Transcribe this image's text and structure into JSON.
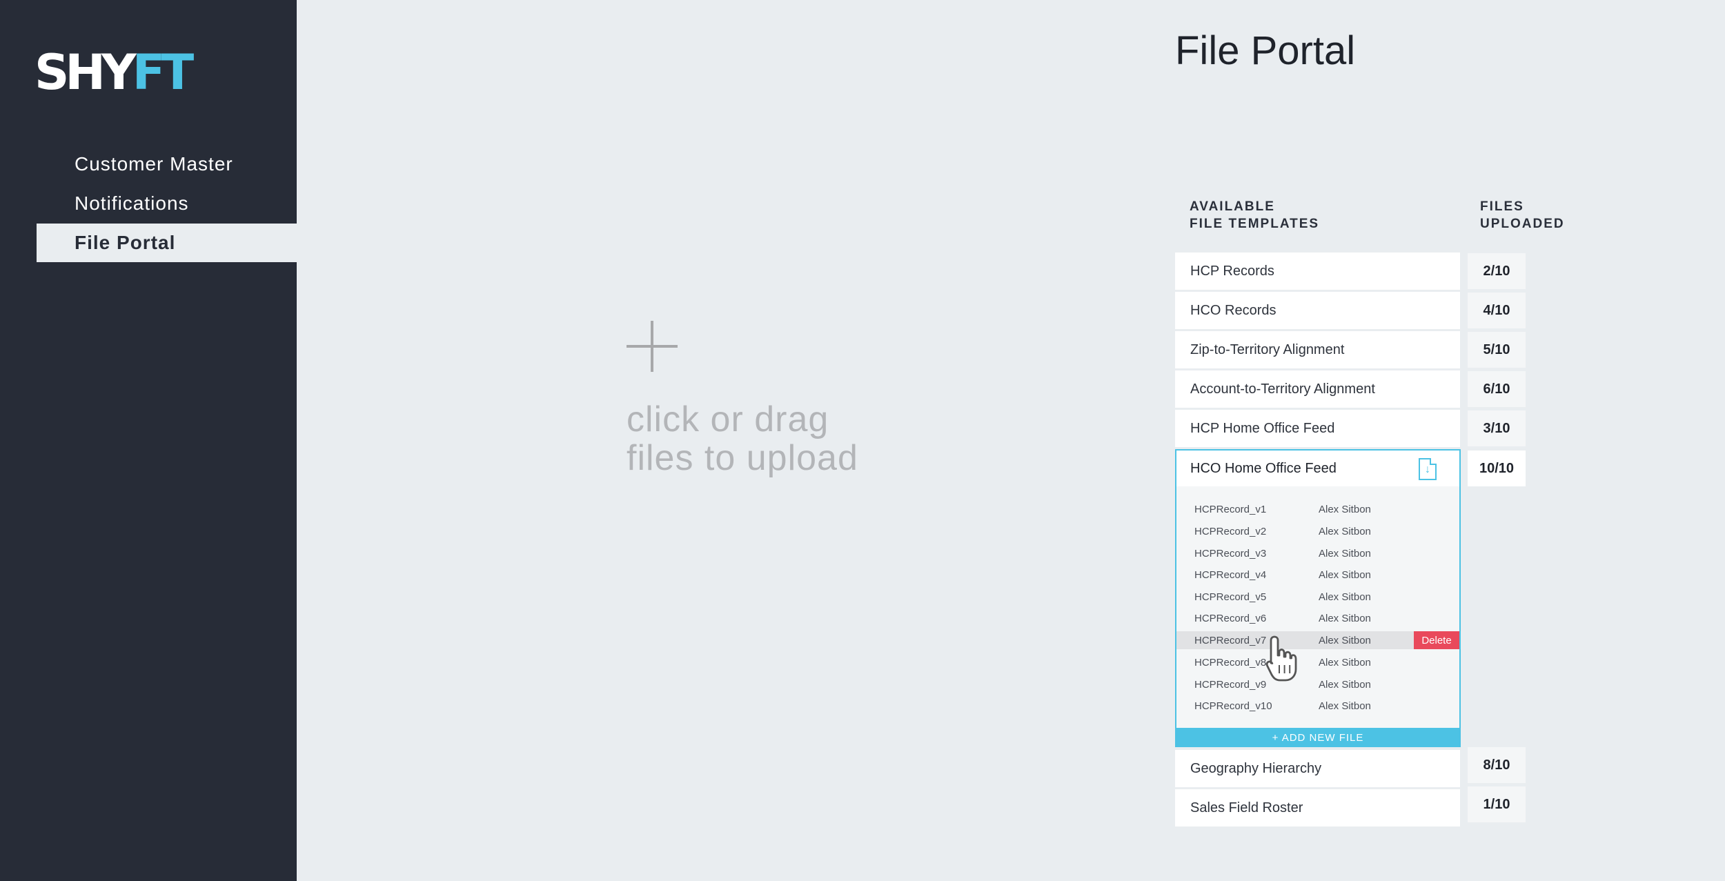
{
  "brand": {
    "logo_white": "SHY",
    "logo_blue": "FT",
    "accent": "#4cc2e4",
    "sidebar_bg": "#272c37"
  },
  "nav": {
    "items": [
      {
        "label": "Customer Master"
      },
      {
        "label": "Notifications"
      },
      {
        "label": "File Portal",
        "active": true
      }
    ]
  },
  "upload": {
    "line1": "click or drag",
    "line2": "files to upload"
  },
  "page": {
    "title": "File Portal"
  },
  "columns": {
    "templates_line1": "AVAILABLE",
    "templates_line2": "FILE TEMPLATES",
    "uploaded_line1": "FILES",
    "uploaded_line2": "UPLOADED"
  },
  "templates": [
    {
      "name": "HCP Records",
      "count": "2/10"
    },
    {
      "name": "HCO Records",
      "count": "4/10"
    },
    {
      "name": "Zip-to-Territory Alignment",
      "count": "5/10"
    },
    {
      "name": "Account-to-Territory Alignment",
      "count": "6/10"
    },
    {
      "name": "HCP Home Office Feed",
      "count": "3/10"
    },
    {
      "name": "HCO Home Office Feed",
      "count": "10/10",
      "expanded": true
    },
    {
      "name": "Geography Hierarchy",
      "count": "8/10"
    },
    {
      "name": "Sales Field Roster",
      "count": "1/10"
    }
  ],
  "files": [
    {
      "name": "HCPRecord_v1",
      "owner": "Alex Sitbon"
    },
    {
      "name": "HCPRecord_v2",
      "owner": "Alex Sitbon"
    },
    {
      "name": "HCPRecord_v3",
      "owner": "Alex Sitbon"
    },
    {
      "name": "HCPRecord_v4",
      "owner": "Alex Sitbon"
    },
    {
      "name": "HCPRecord_v5",
      "owner": "Alex Sitbon"
    },
    {
      "name": "HCPRecord_v6",
      "owner": "Alex Sitbon"
    },
    {
      "name": "HCPRecord_v7",
      "owner": "Alex Sitbon",
      "hovered": true
    },
    {
      "name": "HCPRecord_v8",
      "owner": "Alex Sitbon"
    },
    {
      "name": "HCPRecord_v9",
      "owner": "Alex Sitbon"
    },
    {
      "name": "HCPRecord_v10",
      "owner": "Alex Sitbon"
    }
  ],
  "actions": {
    "delete_label": "Delete",
    "add_file_label": "+ ADD NEW FILE",
    "download_icon": "download-file-icon"
  }
}
